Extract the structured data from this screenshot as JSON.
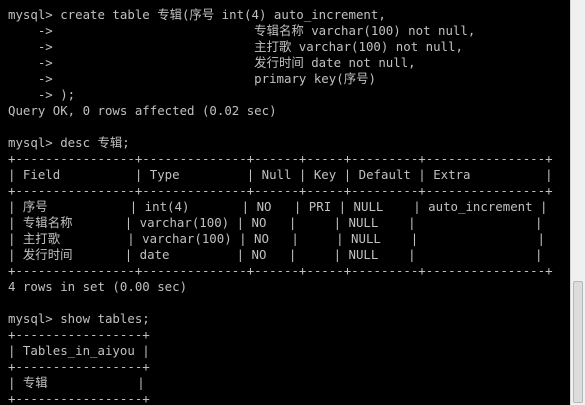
{
  "console": {
    "lines": [
      "mysql> create table 专辑(序号 int(4) auto_increment,",
      "    ->                           专辑名称 varchar(100) not null,",
      "    ->                           主打歌 varchar(100) not null,",
      "    ->                           发行时间 date not null,",
      "    ->                           primary key(序号)",
      "    -> );",
      "Query OK, 0 rows affected (0.02 sec)",
      "",
      "mysql> desc 专辑;",
      "+----------------+--------------+------+-----+---------+----------------+",
      "| Field          | Type         | Null | Key | Default | Extra          |",
      "+----------------+--------------+------+-----+---------+----------------+",
      "| 序号           | int(4)       | NO   | PRI | NULL    | auto_increment |",
      "| 专辑名称       | varchar(100) | NO   |     | NULL    |                |",
      "| 主打歌         | varchar(100) | NO   |     | NULL    |                |",
      "| 发行时间       | date         | NO   |     | NULL    |                |",
      "+----------------+--------------+------+-----+---------+----------------+",
      "4 rows in set (0.00 sec)",
      "",
      "mysql> show tables;",
      "+-----------------+",
      "| Tables_in_aiyou |",
      "+-----------------+",
      "| 专辑            |",
      "+-----------------+"
    ]
  },
  "colors": {
    "background": "#000000",
    "text": "#c0c0c0"
  }
}
